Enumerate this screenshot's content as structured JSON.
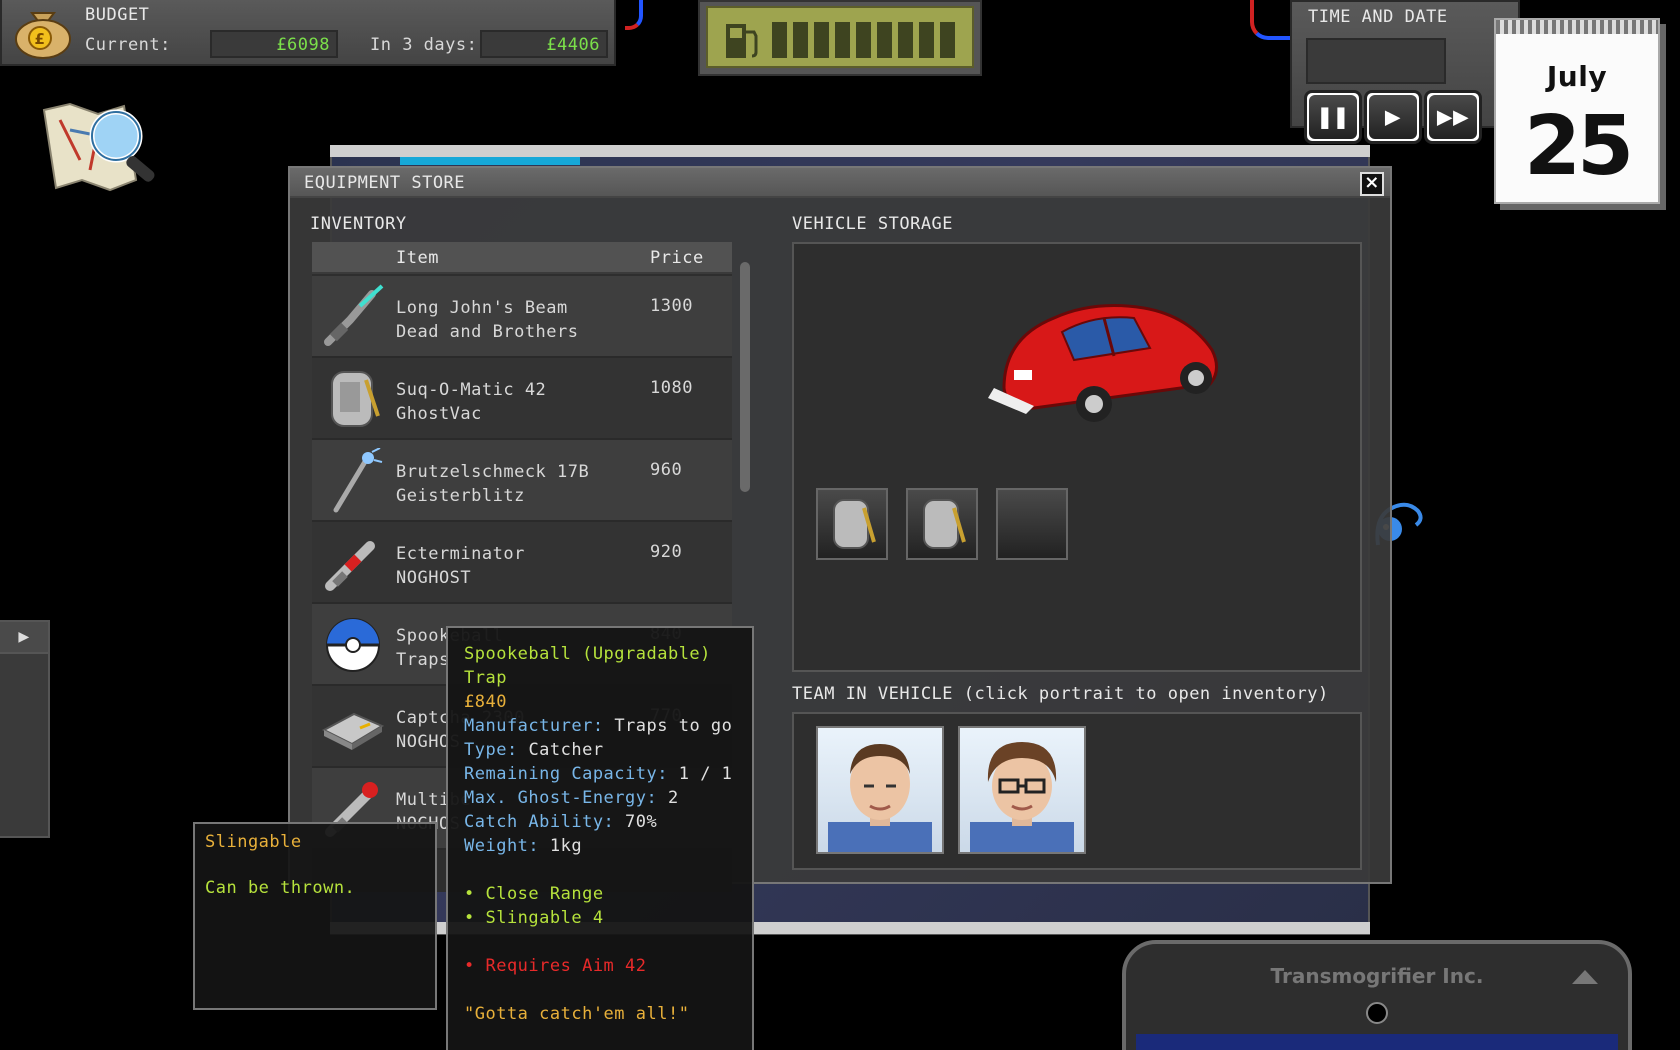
{
  "budget": {
    "title": "BUDGET",
    "current_label": "Current:",
    "current_value": "£6098",
    "in3days_label": "In 3 days:",
    "in3days_value": "£4406"
  },
  "fuel": {
    "bars": 9
  },
  "time": {
    "title": "TIME AND DATE",
    "calendar_month": "July",
    "calendar_day": "25"
  },
  "store": {
    "title": "EQUIPMENT STORE",
    "close_label": "×",
    "inventory_label": "INVENTORY",
    "columns": {
      "item": "Item",
      "price": "Price"
    },
    "items": [
      {
        "name": "Long John's Beam",
        "maker": "Dead and Brothers",
        "price": "1300",
        "icon": "beam-gun-icon"
      },
      {
        "name": "Suq-O-Matic 42",
        "maker": "GhostVac",
        "price": "1080",
        "icon": "ghost-vacuum-icon"
      },
      {
        "name": "Brutzelschmeck 17B",
        "maker": "Geisterblitz",
        "price": "960",
        "icon": "lightning-staff-icon"
      },
      {
        "name": "Ecterminator",
        "maker": "NOGHOST",
        "price": "920",
        "icon": "ecto-blaster-icon"
      },
      {
        "name": "Spookeball",
        "maker": "Traps",
        "price": "840",
        "icon": "spookeball-icon"
      },
      {
        "name": "Captcha 2300",
        "maker": "NOGHOS",
        "price": "770",
        "icon": "trap-box-icon"
      },
      {
        "name": "Multibe",
        "maker": "NOGHOS",
        "price": "",
        "icon": "multibeam-gun-icon"
      }
    ],
    "vehicle_label": "VEHICLE STORAGE",
    "team_label": "TEAM IN VEHICLE (click portrait to open inventory)"
  },
  "tooltip_item": {
    "name": "Spookeball (Upgradable)",
    "category": "Trap",
    "price": "£840",
    "manufacturer_label": "Manufacturer:",
    "manufacturer": "Traps to go",
    "type_label": "Type:",
    "type": "Catcher",
    "capacity_label": "Remaining Capacity:",
    "capacity": "1 /  1",
    "energy_label": "Max. Ghost-Energy:",
    "energy": "2",
    "catch_label": "Catch Ability:",
    "catch": "70%",
    "weight_label": "Weight:",
    "weight": "1kg",
    "perk1": "• Close Range",
    "perk2": "• Slingable 4",
    "requirement": "• Requires Aim 42",
    "quote": "\"Gotta catch'em all!\""
  },
  "tooltip_slingable": {
    "title": "Slingable",
    "description": "Can be thrown."
  },
  "phone": {
    "brand": "Transmogrifier Inc."
  },
  "colors": {
    "money_green": "#7be04a",
    "tooltip_green": "#b6e23c",
    "tooltip_orange": "#e8b03a",
    "tooltip_blue": "#78b6e8",
    "tooltip_red": "#e82a2a",
    "car_red": "#d81818"
  }
}
